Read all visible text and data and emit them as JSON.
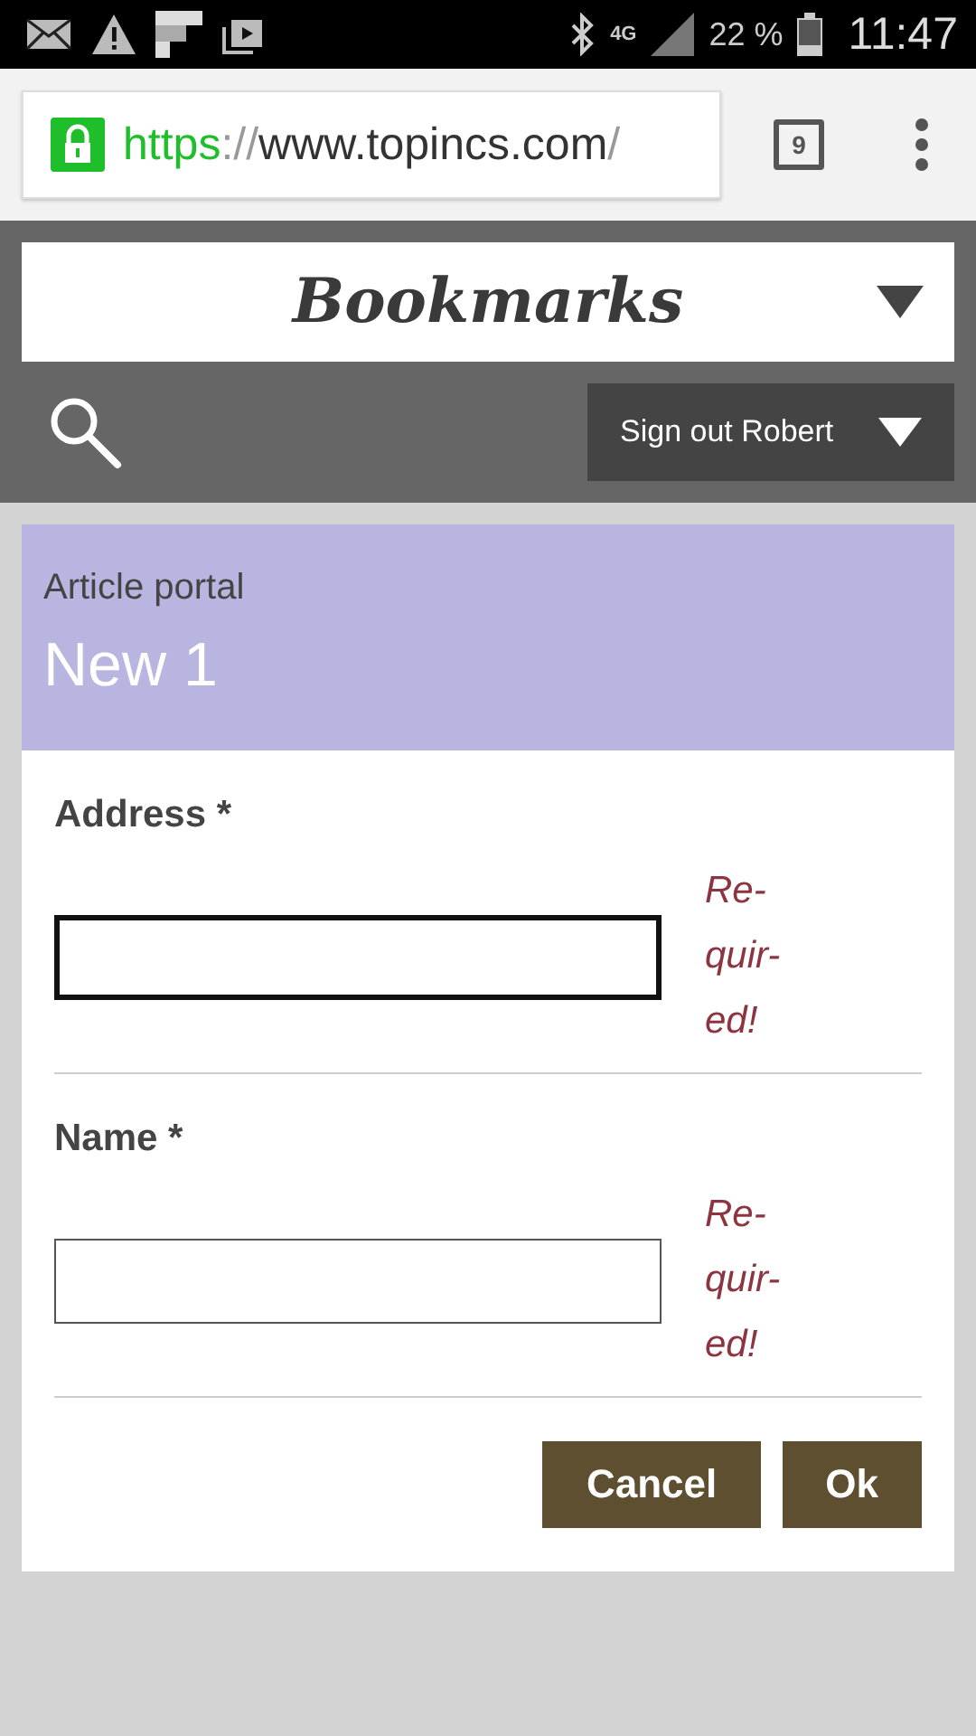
{
  "status_bar": {
    "network": "4G",
    "battery": "22 %",
    "time": "11:47"
  },
  "browser": {
    "url": [
      {
        "kind": "scheme",
        "text": "https"
      },
      {
        "kind": "muted",
        "text": "://"
      },
      {
        "kind": "host",
        "text": "www.topincs.com"
      },
      {
        "kind": "muted",
        "text": "/"
      }
    ],
    "tab_count": "9"
  },
  "header": {
    "title": "Bookmarks",
    "sign_out": "Sign out Robert"
  },
  "card": {
    "subtitle": "Article portal",
    "title": "New 1",
    "fields": [
      {
        "label": "Address *",
        "focused": true,
        "error": [
          "Re-",
          "quir-",
          "ed!"
        ]
      },
      {
        "label": "Name *",
        "focused": false,
        "error": [
          "Re-",
          "quir-",
          "ed!"
        ]
      }
    ],
    "buttons": [
      "Cancel",
      "Ok"
    ]
  }
}
